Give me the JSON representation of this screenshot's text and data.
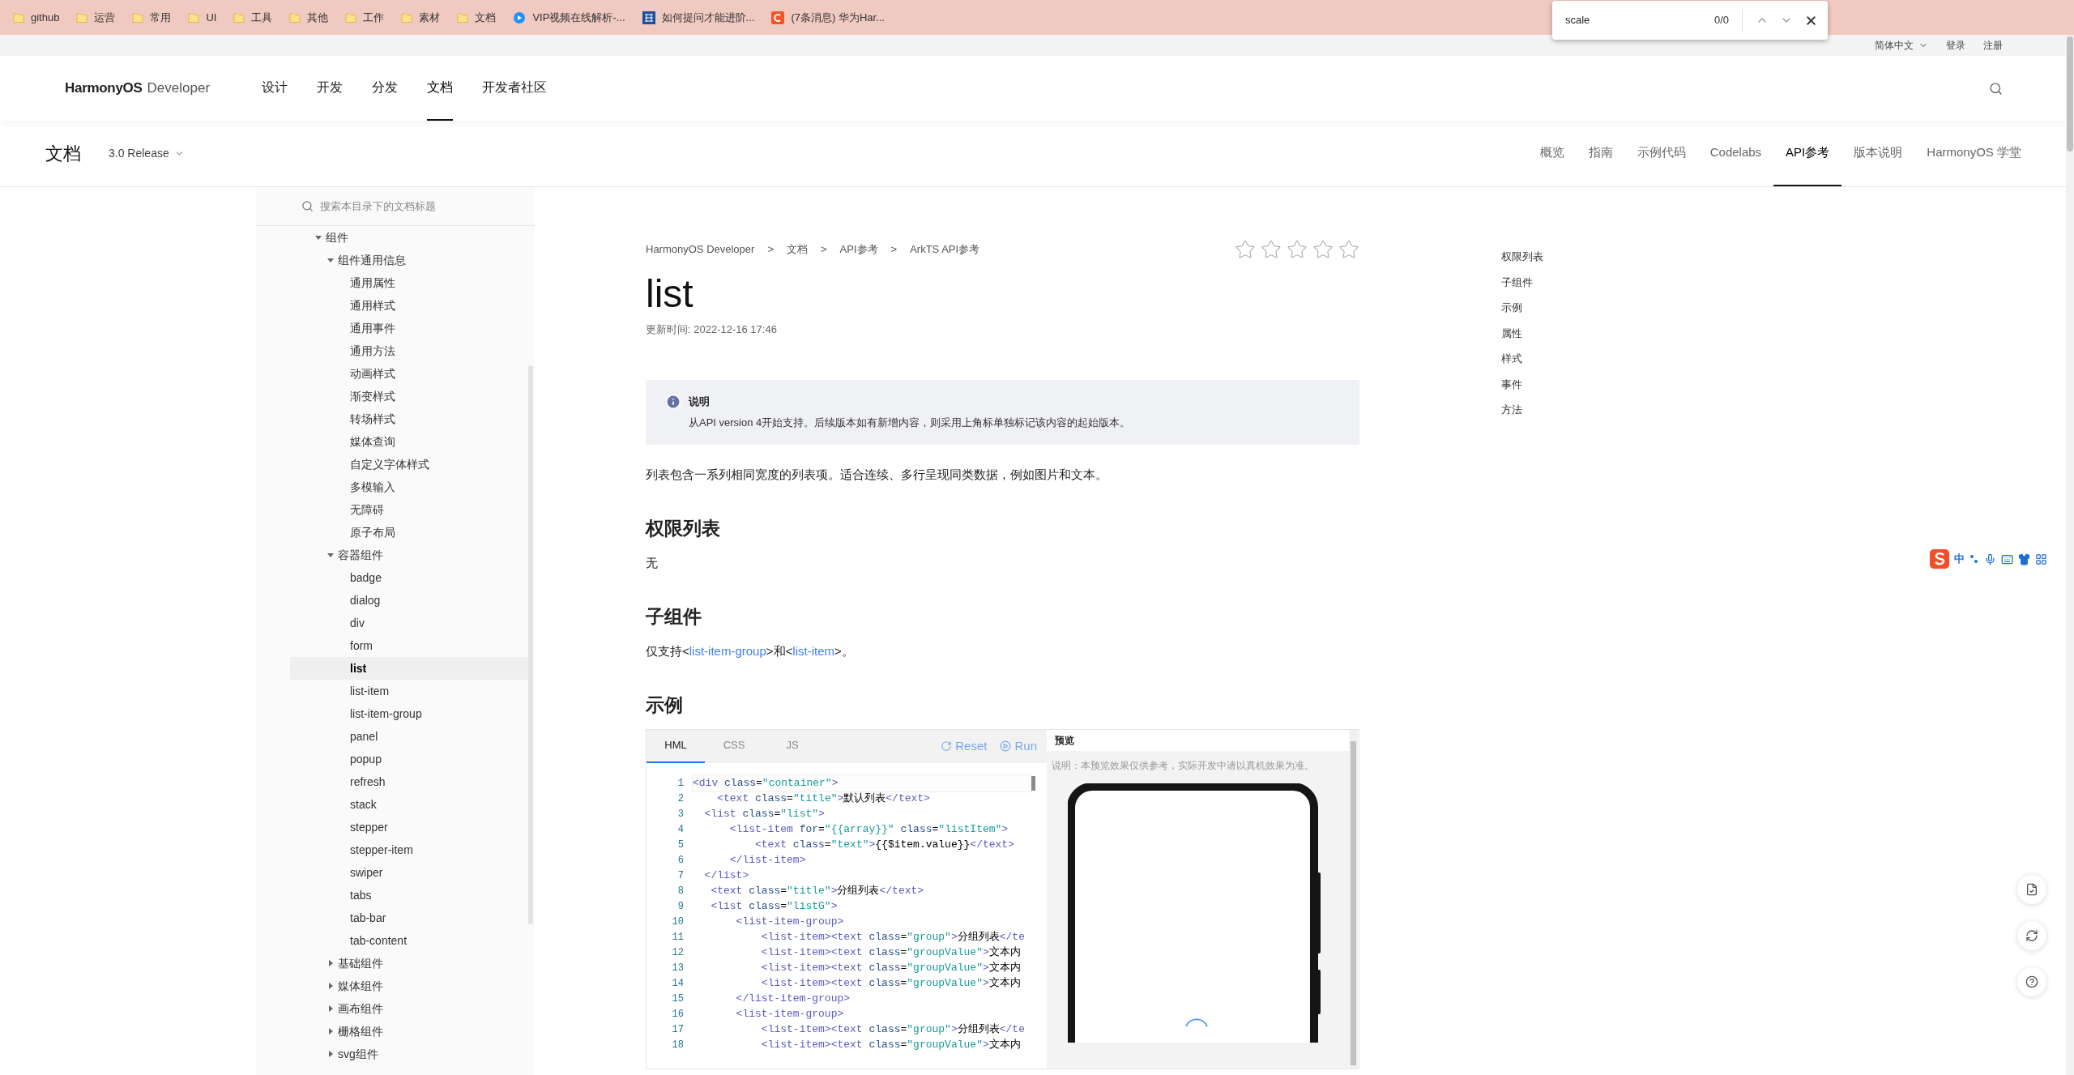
{
  "bookmarks": [
    {
      "label": "github",
      "kind": "folder"
    },
    {
      "label": "运营",
      "kind": "folder"
    },
    {
      "label": "常用",
      "kind": "folder"
    },
    {
      "label": "UI",
      "kind": "folder"
    },
    {
      "label": "工具",
      "kind": "folder"
    },
    {
      "label": "其他",
      "kind": "folder"
    },
    {
      "label": "工作",
      "kind": "folder"
    },
    {
      "label": "素材",
      "kind": "folder"
    },
    {
      "label": "文档",
      "kind": "folder"
    },
    {
      "label": "VIP视频在线解析-...",
      "kind": "play"
    },
    {
      "label": "如何提问才能进阶...",
      "kind": "grid"
    },
    {
      "label": "(7条消息) 华为Har...",
      "kind": "letter"
    }
  ],
  "find_bar": {
    "value": "scale",
    "count": "0/0"
  },
  "top_links": {
    "language": "简体中文",
    "login": "登录",
    "register": "注册"
  },
  "nav": {
    "brand": "HarmonyOS",
    "suffix": "Developer",
    "items": [
      {
        "label": "设计",
        "selected": false
      },
      {
        "label": "开发",
        "selected": false
      },
      {
        "label": "分发",
        "selected": false
      },
      {
        "label": "文档",
        "selected": true
      },
      {
        "label": "开发者社区",
        "selected": false
      }
    ]
  },
  "doc_header": {
    "title": "文档",
    "version": "3.0 Release",
    "tabs": [
      {
        "label": "概览",
        "selected": false
      },
      {
        "label": "指南",
        "selected": false
      },
      {
        "label": "示例代码",
        "selected": false
      },
      {
        "label": "Codelabs",
        "selected": false
      },
      {
        "label": "API参考",
        "selected": true
      },
      {
        "label": "版本说明",
        "selected": false
      },
      {
        "label": "HarmonyOS 学堂",
        "selected": false
      }
    ]
  },
  "sidebar": {
    "search_placeholder": "搜索本目录下的文档标题",
    "tree": [
      {
        "label": "组件",
        "expanded": true,
        "selected": false,
        "children": [
          {
            "label": "组件通用信息",
            "expanded": true,
            "selected": false,
            "children": [
              {
                "label": "通用属性",
                "selected": false
              },
              {
                "label": "通用样式",
                "selected": false
              },
              {
                "label": "通用事件",
                "selected": false
              },
              {
                "label": "通用方法",
                "selected": false
              },
              {
                "label": "动画样式",
                "selected": false
              },
              {
                "label": "渐变样式",
                "selected": false
              },
              {
                "label": "转场样式",
                "selected": false
              },
              {
                "label": "媒体查询",
                "selected": false
              },
              {
                "label": "自定义字体样式",
                "selected": false
              },
              {
                "label": "多模输入",
                "selected": false
              },
              {
                "label": "无障碍",
                "selected": false
              },
              {
                "label": "原子布局",
                "selected": false
              }
            ]
          },
          {
            "label": "容器组件",
            "expanded": true,
            "selected": false,
            "children": [
              {
                "label": "badge",
                "selected": false
              },
              {
                "label": "dialog",
                "selected": false
              },
              {
                "label": "div",
                "selected": false
              },
              {
                "label": "form",
                "selected": false
              },
              {
                "label": "list",
                "selected": true
              },
              {
                "label": "list-item",
                "selected": false
              },
              {
                "label": "list-item-group",
                "selected": false
              },
              {
                "label": "panel",
                "selected": false
              },
              {
                "label": "popup",
                "selected": false
              },
              {
                "label": "refresh",
                "selected": false
              },
              {
                "label": "stack",
                "selected": false
              },
              {
                "label": "stepper",
                "selected": false
              },
              {
                "label": "stepper-item",
                "selected": false
              },
              {
                "label": "swiper",
                "selected": false
              },
              {
                "label": "tabs",
                "selected": false
              },
              {
                "label": "tab-bar",
                "selected": false
              },
              {
                "label": "tab-content",
                "selected": false
              }
            ]
          },
          {
            "label": "基础组件",
            "expanded": false,
            "selected": false
          },
          {
            "label": "媒体组件",
            "expanded": false,
            "selected": false
          },
          {
            "label": "画布组件",
            "expanded": false,
            "selected": false
          },
          {
            "label": "栅格组件",
            "expanded": false,
            "selected": false
          },
          {
            "label": "svg组件",
            "expanded": false,
            "selected": false
          }
        ]
      }
    ]
  },
  "article": {
    "breadcrumb": [
      {
        "label": "HarmonyOS Developer",
        "separator": ">"
      },
      {
        "label": "文档",
        "separator": ">"
      },
      {
        "label": "API参考",
        "separator": ">"
      },
      {
        "label": "ArkTS API参考"
      }
    ],
    "stars": 0,
    "title": "list",
    "updated": "更新时间: 2022-12-16 17:46",
    "note": {
      "title": "说明",
      "text": "从API version 4开始支持。后续版本如有新增内容，则采用上角标单独标记该内容的起始版本。"
    },
    "intro": "列表包含一系列相同宽度的列表项。适合连续、多行呈现同类数据，例如图片和文本。",
    "sections": [
      {
        "heading": "权限列表",
        "parts": [
          {
            "kind": "plain",
            "text": "无"
          }
        ]
      },
      {
        "heading": "子组件",
        "parts": [
          {
            "kind": "plain",
            "text": "仅支持<"
          },
          {
            "kind": "link",
            "text": "list-item-group"
          },
          {
            "kind": "plain",
            "text": ">和<"
          },
          {
            "kind": "link",
            "text": "list-item"
          },
          {
            "kind": "plain",
            "text": ">。"
          }
        ]
      }
    ],
    "example_heading": "示例"
  },
  "code_editor": {
    "tabs": [
      {
        "label": "HML",
        "selected": true
      },
      {
        "label": "CSS",
        "selected": false
      },
      {
        "label": "JS",
        "selected": false
      }
    ],
    "actions": [
      {
        "label": "Reset",
        "kind": "reset"
      },
      {
        "label": "Run",
        "kind": "run"
      }
    ],
    "lines": [
      {
        "number": "1",
        "text": "<div class=\"container\">",
        "current": true
      },
      {
        "number": "2",
        "text": "    <text class=\"title\">默认列表</text>",
        "current": false
      },
      {
        "number": "3",
        "text": "  <list class=\"list\">",
        "current": false
      },
      {
        "number": "4",
        "text": "      <list-item for=\"{{array}}\" class=\"listItem\">",
        "current": false
      },
      {
        "number": "5",
        "text": "          <text class=\"text\">{{$item.value}}</text>",
        "current": false
      },
      {
        "number": "6",
        "text": "      </list-item>",
        "current": false
      },
      {
        "number": "7",
        "text": "  </list>",
        "current": false
      },
      {
        "number": "8",
        "text": "   <text class=\"title\">分组列表</text>",
        "current": false
      },
      {
        "number": "9",
        "text": "   <list class=\"listG\">",
        "current": false
      },
      {
        "number": "10",
        "text": "       <list-item-group>",
        "current": false
      },
      {
        "number": "11",
        "text": "           <list-item><text class=\"group\">分组列表</te",
        "current": false
      },
      {
        "number": "12",
        "text": "           <list-item><text class=\"groupValue\">文本内",
        "current": false
      },
      {
        "number": "13",
        "text": "           <list-item><text class=\"groupValue\">文本内",
        "current": false
      },
      {
        "number": "14",
        "text": "           <list-item><text class=\"groupValue\">文本内",
        "current": false
      },
      {
        "number": "15",
        "text": "       </list-item-group>",
        "current": false
      },
      {
        "number": "16",
        "text": "       <list-item-group>",
        "current": false
      },
      {
        "number": "17",
        "text": "           <list-item><text class=\"group\">分组列表</te",
        "current": false
      },
      {
        "number": "18",
        "text": "           <list-item><text class=\"groupValue\">文本内",
        "current": false
      }
    ],
    "preview": {
      "title": "预览",
      "note": "说明：本预览效果仅供参考，实际开发中请以真机效果为准。"
    }
  },
  "toc": [
    "权限列表",
    "子组件",
    "示例",
    "属性",
    "样式",
    "事件",
    "方法"
  ],
  "ime_toolbar": {
    "mode": "中"
  }
}
